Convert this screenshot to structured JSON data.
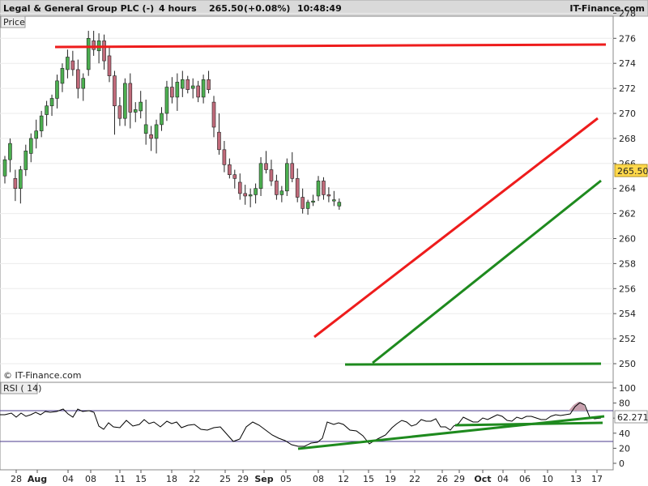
{
  "header": {
    "instrument": "Legal & General Group PLC (-)",
    "timeframe": "4 hours",
    "price": "265.50",
    "change": "(+0.08%)",
    "time": "10:48:49",
    "brand": "IT-Finance.com"
  },
  "price_panel": {
    "label": "Price",
    "watermark": "© IT-Finance.com",
    "last_price_label": "265.50"
  },
  "rsi_panel": {
    "label": "RSI ( 14)",
    "last_value_label": "62.271"
  },
  "colors": {
    "bull": "#4caf50",
    "bear": "#c06a7a",
    "resistance": "#ee1c1c",
    "support": "#1e8a1e",
    "rsi_line": "#000000",
    "rsi_levels": "#4a3a8c",
    "price_tag": "#ffd84a"
  },
  "chart_data": [
    {
      "type": "candlestick",
      "ylim": [
        249,
        278
      ],
      "y_ticks": [
        250,
        252,
        254,
        256,
        258,
        260,
        262,
        264,
        266,
        268,
        270,
        272,
        274,
        276,
        278
      ],
      "x_ticks": [
        {
          "i": 1,
          "label": "28",
          "bold": false
        },
        {
          "i": 6,
          "label": "Aug",
          "bold": true
        },
        {
          "i": 12,
          "label": "04",
          "bold": false
        },
        {
          "i": 16,
          "label": "08",
          "bold": false
        },
        {
          "i": 22,
          "label": "11",
          "bold": false
        },
        {
          "i": 26,
          "label": "15",
          "bold": false
        },
        {
          "i": 31,
          "label": "18",
          "bold": false
        },
        {
          "i": 36,
          "label": "22",
          "bold": false
        },
        {
          "i": 41,
          "label": "25",
          "bold": false
        },
        {
          "i": 46,
          "label": "29",
          "bold": false
        },
        {
          "i": 50,
          "label": "Sep",
          "bold": true
        },
        {
          "i": 55,
          "label": "05",
          "bold": false
        },
        {
          "i": 61,
          "label": "08",
          "bold": false
        },
        {
          "i": 66,
          "label": "12",
          "bold": false
        },
        {
          "i": 71,
          "label": "15",
          "bold": false
        },
        {
          "i": 75,
          "label": "19",
          "bold": false
        },
        {
          "i": 80,
          "label": "22",
          "bold": false
        },
        {
          "i": 85,
          "label": "26",
          "bold": false
        },
        {
          "i": 90,
          "label": "29",
          "bold": false
        },
        {
          "i": 93,
          "label": "Oct",
          "bold": true
        },
        {
          "i": 97,
          "label": "04",
          "bold": false
        },
        {
          "i": 101,
          "label": "06",
          "bold": false
        },
        {
          "i": 106,
          "label": "10",
          "bold": false
        },
        {
          "i": 112,
          "label": "13",
          "bold": false
        },
        {
          "i": 115,
          "label": "17",
          "bold": false
        }
      ],
      "candles": [
        [
          265.0,
          266.6,
          264.4,
          266.3
        ],
        [
          266.3,
          268.0,
          265.3,
          267.6
        ],
        [
          264.8,
          265.5,
          263.0,
          264.0
        ],
        [
          264.0,
          265.8,
          262.8,
          265.5
        ],
        [
          265.5,
          267.5,
          265.0,
          267.0
        ],
        [
          266.8,
          268.4,
          266.1,
          268.0
        ],
        [
          268.0,
          269.5,
          267.2,
          268.6
        ],
        [
          268.6,
          270.2,
          268.1,
          269.8
        ],
        [
          269.9,
          271.0,
          269.0,
          270.6
        ],
        [
          270.6,
          271.5,
          269.8,
          271.2
        ],
        [
          271.2,
          273.1,
          270.4,
          272.6
        ],
        [
          272.4,
          274.0,
          271.7,
          273.6
        ],
        [
          273.5,
          275.1,
          272.8,
          274.5
        ],
        [
          274.2,
          275.0,
          273.0,
          273.5
        ],
        [
          273.5,
          274.3,
          271.2,
          272.0
        ],
        [
          272.0,
          273.2,
          271.0,
          272.8
        ],
        [
          273.5,
          276.6,
          273.0,
          276.0
        ],
        [
          275.8,
          276.6,
          274.6,
          275.1
        ],
        [
          275.0,
          276.4,
          274.0,
          275.8
        ],
        [
          275.8,
          276.3,
          273.5,
          274.2
        ],
        [
          274.6,
          275.3,
          272.5,
          273.0
        ],
        [
          273.0,
          273.4,
          268.3,
          270.6
        ],
        [
          270.6,
          271.3,
          269.0,
          269.6
        ],
        [
          269.6,
          272.8,
          269.0,
          272.4
        ],
        [
          272.4,
          273.2,
          268.8,
          270.1
        ],
        [
          270.1,
          270.9,
          269.3,
          270.3
        ],
        [
          270.2,
          271.8,
          269.6,
          270.9
        ],
        [
          268.4,
          271.1,
          267.5,
          269.1
        ],
        [
          268.3,
          269.0,
          267.0,
          268.0
        ],
        [
          268.0,
          269.5,
          266.8,
          269.1
        ],
        [
          269.1,
          270.5,
          268.6,
          270.0
        ],
        [
          270.0,
          272.6,
          269.4,
          272.1
        ],
        [
          272.1,
          272.9,
          270.8,
          271.3
        ],
        [
          271.3,
          273.2,
          270.2,
          272.5
        ],
        [
          272.0,
          273.4,
          271.3,
          272.7
        ],
        [
          272.7,
          273.0,
          271.6,
          271.9
        ],
        [
          272.0,
          272.8,
          271.2,
          272.2
        ],
        [
          272.2,
          272.6,
          270.9,
          271.3
        ],
        [
          271.3,
          273.1,
          270.8,
          272.7
        ],
        [
          272.7,
          273.4,
          271.6,
          271.9
        ],
        [
          270.9,
          271.4,
          268.1,
          268.9
        ],
        [
          268.5,
          270.0,
          266.7,
          267.1
        ],
        [
          267.1,
          267.8,
          265.3,
          265.9
        ],
        [
          265.9,
          266.4,
          264.8,
          265.1
        ],
        [
          265.1,
          265.5,
          264.0,
          264.8
        ],
        [
          264.5,
          265.2,
          263.1,
          263.6
        ],
        [
          263.6,
          264.3,
          262.7,
          263.4
        ],
        [
          263.4,
          264.0,
          262.5,
          263.5
        ],
        [
          263.5,
          264.4,
          262.8,
          264.0
        ],
        [
          264.0,
          266.5,
          263.4,
          266.0
        ],
        [
          266.0,
          267.0,
          265.2,
          265.5
        ],
        [
          265.5,
          266.3,
          264.2,
          264.6
        ],
        [
          264.6,
          265.1,
          263.1,
          263.5
        ],
        [
          263.5,
          264.2,
          262.9,
          263.8
        ],
        [
          263.8,
          266.4,
          263.4,
          266.0
        ],
        [
          266.0,
          266.9,
          264.5,
          264.8
        ],
        [
          264.8,
          265.6,
          262.9,
          263.3
        ],
        [
          263.3,
          264.0,
          262.0,
          262.4
        ],
        [
          262.4,
          263.1,
          261.9,
          262.9
        ],
        [
          262.9,
          263.5,
          262.6,
          263.0
        ],
        [
          263.4,
          265.0,
          263.0,
          264.6
        ],
        [
          264.6,
          264.9,
          263.1,
          263.5
        ],
        [
          263.5,
          264.1,
          262.9,
          263.4
        ],
        [
          263.0,
          263.8,
          262.6,
          263.1
        ],
        [
          262.6,
          263.2,
          262.3,
          262.9
        ]
      ]
    },
    {
      "type": "line",
      "name": "RSI ( 14)",
      "ylim": [
        0,
        100
      ],
      "y_ticks": [
        0,
        20,
        40,
        60,
        80,
        100
      ],
      "levels": [
        30,
        70
      ],
      "last_value": 62.271
    }
  ]
}
